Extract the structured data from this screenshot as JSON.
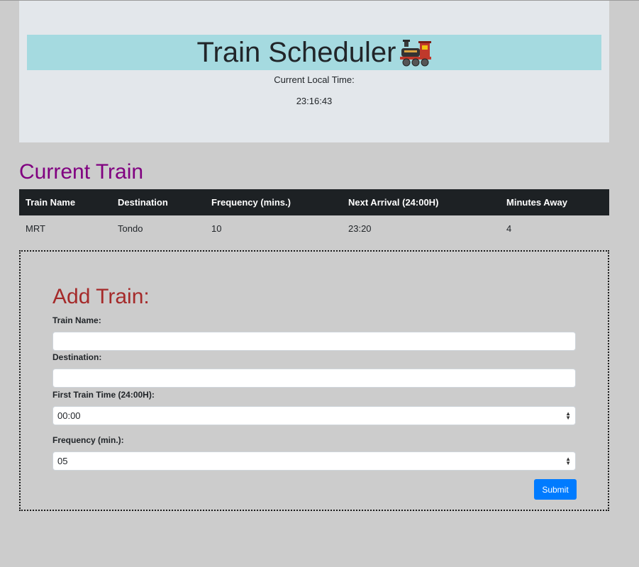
{
  "header": {
    "title": "Train Scheduler",
    "icon": "locomotive-icon",
    "clock_label": "Current Local Time:",
    "clock_value": "23:16:43"
  },
  "current_trains": {
    "heading": "Current Train",
    "columns": [
      "Train Name",
      "Destination",
      "Frequency (mins.)",
      "Next Arrival (24:00H)",
      "Minutes Away"
    ],
    "rows": [
      [
        "MRT",
        "Tondo",
        "10",
        "23:20",
        "4"
      ]
    ]
  },
  "add_train": {
    "heading": "Add Train:",
    "train_name_label": "Train Name:",
    "train_name_value": "",
    "destination_label": "Destination:",
    "destination_value": "",
    "first_time_label": "First Train Time (24:00H):",
    "first_time_value": "00:00",
    "frequency_label": "Frequency (min.):",
    "frequency_value": "05",
    "submit_label": "Submit"
  },
  "colors": {
    "background": "#cccccc",
    "title_bar": "#a5dae0",
    "section_heading": "#800080",
    "form_heading": "#a52a2a",
    "table_header": "#1d2124",
    "submit": "#007bff"
  }
}
